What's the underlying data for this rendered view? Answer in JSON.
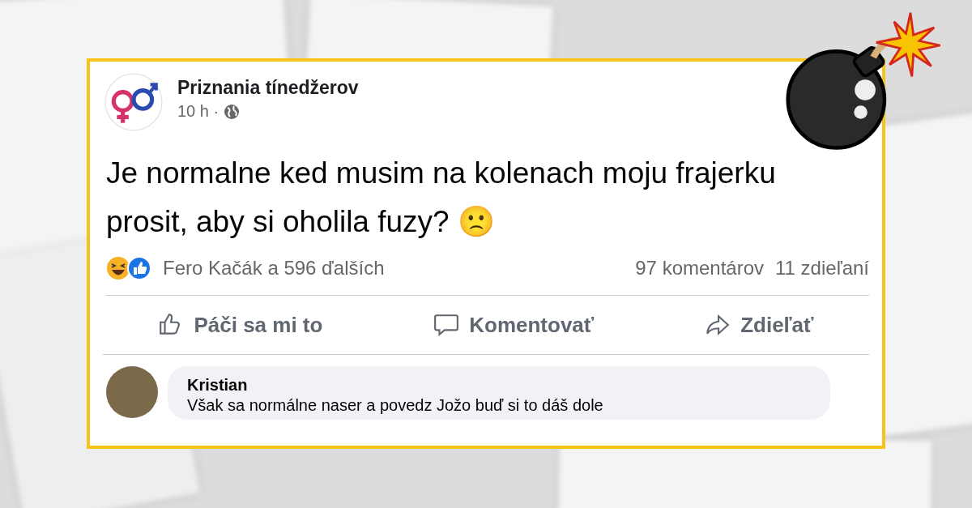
{
  "post": {
    "author": "Priznania tínedžerov",
    "time": "10 h ·",
    "text": "Je normalne ked musim na kolenach moju frajerku prosit, aby si oholila fuzy? 🙁"
  },
  "reactions": {
    "names": "Fero Kačák a 596 ďalších",
    "comments": "97 komentárov",
    "shares": "11 zdieľaní"
  },
  "actions": [
    {
      "kind": "like",
      "label": "Páči sa mi to"
    },
    {
      "kind": "comment",
      "label": "Komentovať"
    },
    {
      "kind": "share",
      "label": "Zdieľať"
    }
  ],
  "comment": {
    "author": "Kristian",
    "text": "Však sa normálne naser a povedz Jožo buď si to dáš dole"
  }
}
